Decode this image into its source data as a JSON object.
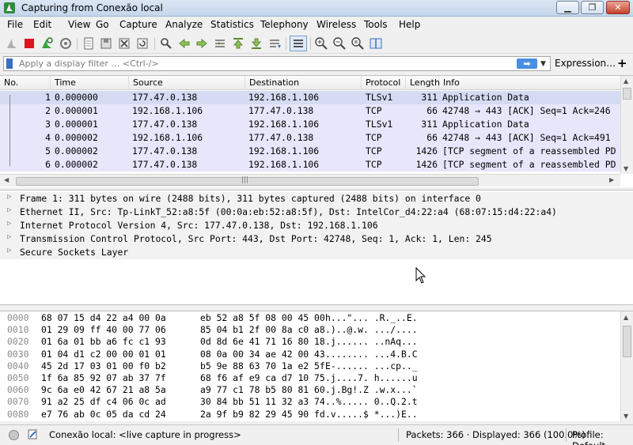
{
  "window": {
    "title": "Capturing from Conexão local"
  },
  "menu": [
    "File",
    "Edit",
    "View",
    "Go",
    "Capture",
    "Analyze",
    "Statistics",
    "Telephony",
    "Wireless",
    "Tools",
    "Help"
  ],
  "toolbar_icons": [
    "shark-fin-start-icon",
    "stop-icon",
    "restart-icon",
    "capture-options-icon",
    "open-file-icon",
    "save-file-icon",
    "close-file-icon",
    "reload-icon",
    "find-icon",
    "go-back-icon",
    "go-forward-icon",
    "go-to-packet-icon",
    "go-first-icon",
    "go-last-icon",
    "autoscroll-icon",
    "colorize-icon",
    "zoom-in-icon",
    "zoom-out-icon",
    "zoom-normal-icon",
    "resize-columns-icon"
  ],
  "filter": {
    "placeholder": "Apply a display filter … <Ctrl-/>",
    "apply_label": "➡",
    "expression_label": "Expression…",
    "add_label": "+"
  },
  "packet_list": {
    "columns": [
      "No.",
      "Time",
      "Source",
      "Destination",
      "Protocol",
      "Length",
      "Info"
    ],
    "rows": [
      {
        "no": "1",
        "time": "0.000000",
        "src": "177.47.0.138",
        "dst": "192.168.1.106",
        "proto": "TLSv1",
        "len": "311",
        "info": "Application Data"
      },
      {
        "no": "2",
        "time": "0.000001",
        "src": "192.168.1.106",
        "dst": "177.47.0.138",
        "proto": "TCP",
        "len": "66",
        "info": "42748 → 443 [ACK] Seq=1 Ack=246"
      },
      {
        "no": "3",
        "time": "0.000001",
        "src": "177.47.0.138",
        "dst": "192.168.1.106",
        "proto": "TLSv1",
        "len": "311",
        "info": "Application Data"
      },
      {
        "no": "4",
        "time": "0.000002",
        "src": "192.168.1.106",
        "dst": "177.47.0.138",
        "proto": "TCP",
        "len": "66",
        "info": "42748 → 443 [ACK] Seq=1 Ack=491"
      },
      {
        "no": "5",
        "time": "0.000002",
        "src": "177.47.0.138",
        "dst": "192.168.1.106",
        "proto": "TCP",
        "len": "1426",
        "info": "[TCP segment of a reassembled PD"
      },
      {
        "no": "6",
        "time": "0.000002",
        "src": "177.47.0.138",
        "dst": "192.168.1.106",
        "proto": "TCP",
        "len": "1426",
        "info": "[TCP segment of a reassembled PD"
      }
    ],
    "hscroll_grip": "|||"
  },
  "details": [
    "Frame 1: 311 bytes on wire (2488 bits), 311 bytes captured (2488 bits) on interface 0",
    "Ethernet II, Src: Tp-LinkT_52:a8:5f (00:0a:eb:52:a8:5f), Dst: IntelCor_d4:22:a4 (68:07:15:d4:22:a4)",
    "Internet Protocol Version 4, Src: 177.47.0.138, Dst: 192.168.1.106",
    "Transmission Control Protocol, Src Port: 443, Dst Port: 42748, Seq: 1, Ack: 1, Len: 245",
    "Secure Sockets Layer"
  ],
  "bytes": [
    {
      "off": "0000",
      "h1": "68 07 15 d4 22 a4 00 0a",
      "h2": "eb 52 a8 5f 08 00 45 00",
      "asc": "h...\"... .R._..E."
    },
    {
      "off": "0010",
      "h1": "01 29 09 ff 40 00 77 06",
      "h2": "85 04 b1 2f 00 8a c0 a8",
      "asc": ".)..@.w. .../...."
    },
    {
      "off": "0020",
      "h1": "01 6a 01 bb a6 fc c1 93",
      "h2": "0d 8d 6e 41 71 16 80 18",
      "asc": ".j...... ..nAq..."
    },
    {
      "off": "0030",
      "h1": "01 04 d1 c2 00 00 01 01",
      "h2": "08 0a 00 34 ae 42 00 43",
      "asc": "........ ...4.B.C"
    },
    {
      "off": "0040",
      "h1": "45 2d 17 03 01 00 f0 b2",
      "h2": "b5 9e 88 63 70 1a e2 5f",
      "asc": "E-...... ...cp.._"
    },
    {
      "off": "0050",
      "h1": "1f 6a 85 92 07 ab 37 7f",
      "h2": "68 f6 af e9 ca d7 10 75",
      "asc": ".j....7. h......u"
    },
    {
      "off": "0060",
      "h1": "9c 6a e0 42 67 21 a8 5a",
      "h2": "a9 77 c1 78 b5 80 81 60",
      "asc": ".j.Bg!.Z .w.x...`"
    },
    {
      "off": "0070",
      "h1": "91 a2 25 df c4 06 0c ad",
      "h2": "30 84 bb 51 11 32 a3 74",
      "asc": "..%..... 0..Q.2.t"
    },
    {
      "off": "0080",
      "h1": "e7 76 ab 0c 05 da cd 24",
      "h2": "2a 9f b9 82 29 45 90 fd",
      "asc": ".v.....$ *...)E.."
    }
  ],
  "status": {
    "capture": "Conexão local: <live capture in progress>",
    "packets": "Packets: 366 · Displayed: 366 (100.0%)",
    "profile": "Profile: Default"
  },
  "colors": {
    "row_selected": "#d5dbf2",
    "row_tcp": "#e8e6fb",
    "accent": "#3a6fc4"
  }
}
